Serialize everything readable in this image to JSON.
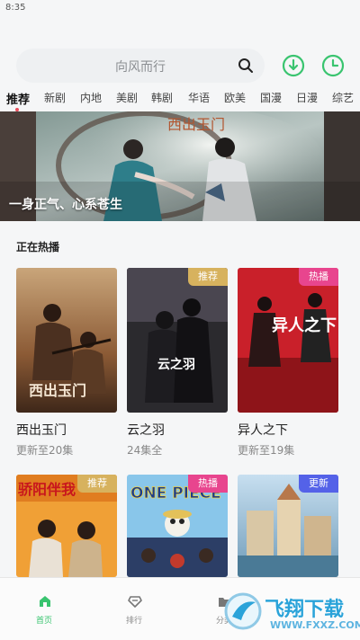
{
  "status": {
    "time": "8:35"
  },
  "search": {
    "placeholder": "向风而行"
  },
  "tabs": [
    "推荐",
    "新剧",
    "内地",
    "美剧",
    "韩剧",
    "华语",
    "欧美",
    "国漫",
    "日漫",
    "综艺"
  ],
  "active_tab": "推荐",
  "banner": {
    "caption": "一身正气、心系苍生",
    "poster_title": "西出玉门"
  },
  "section": {
    "title": "正在热播"
  },
  "cards": [
    {
      "title": "西出玉门",
      "subtitle": "更新至20集",
      "badge": "",
      "poster_text": "西出玉门"
    },
    {
      "title": "云之羽",
      "subtitle": "24集全",
      "badge": "推荐",
      "poster_text": "云之羽"
    },
    {
      "title": "异人之下",
      "subtitle": "更新至19集",
      "badge": "热播",
      "poster_text": "异人之下"
    },
    {
      "title": "",
      "subtitle": "",
      "badge": "推荐",
      "poster_text": "骄阳伴我"
    },
    {
      "title": "",
      "subtitle": "",
      "badge": "热播",
      "poster_text": "ONE PIECE"
    },
    {
      "title": "",
      "subtitle": "",
      "badge": "更新",
      "poster_text": ""
    }
  ],
  "badge_colors": {
    "推荐": "#d7b25e",
    "热播": "#e8458e",
    "更新": "#5462e8"
  },
  "bottom_nav": [
    {
      "label": "首页",
      "icon": "home-icon"
    },
    {
      "label": "排行",
      "icon": "ranking-icon"
    },
    {
      "label": "分类",
      "icon": "category-icon"
    }
  ],
  "watermark": {
    "line1": "飞翔下载",
    "line2": "WWW.FXXZ.COM"
  },
  "colors": {
    "accent": "#39c46f",
    "tab_dot": "#e94b5a"
  }
}
